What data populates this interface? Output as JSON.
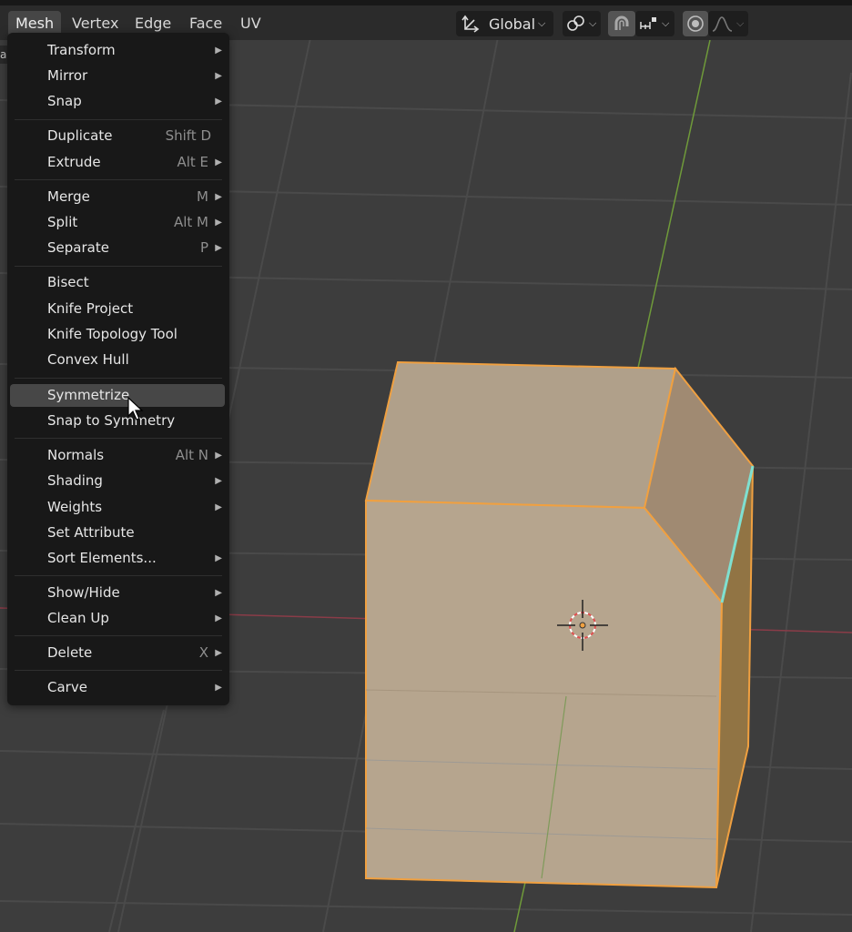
{
  "header": {
    "menus": [
      {
        "label": "Mesh",
        "active": true
      },
      {
        "label": "Vertex",
        "active": false
      },
      {
        "label": "Edge",
        "active": false
      },
      {
        "label": "Face",
        "active": false
      },
      {
        "label": "UV",
        "active": false
      }
    ],
    "orientation_label": "Global",
    "icons": [
      "transform-orientation-icon",
      "pivot-link-icon",
      "snap-magnet-icon",
      "snap-increment-icon",
      "proportional-edit-icon",
      "falloff-curve-icon"
    ]
  },
  "left_tab_label": "a",
  "dropdown": {
    "items": [
      {
        "label": "Transform",
        "shortcut": "",
        "submenu": true
      },
      {
        "label": "Mirror",
        "shortcut": "",
        "submenu": true
      },
      {
        "label": "Snap",
        "shortcut": "",
        "submenu": true
      },
      {
        "label": "Duplicate",
        "shortcut": "Shift D",
        "submenu": false
      },
      {
        "label": "Extrude",
        "shortcut": "Alt E",
        "submenu": true
      },
      {
        "label": "Merge",
        "shortcut": "M",
        "submenu": true
      },
      {
        "label": "Split",
        "shortcut": "Alt M",
        "submenu": true
      },
      {
        "label": "Separate",
        "shortcut": "P",
        "submenu": true
      },
      {
        "label": "Bisect",
        "shortcut": "",
        "submenu": false
      },
      {
        "label": "Knife Project",
        "shortcut": "",
        "submenu": false
      },
      {
        "label": "Knife Topology Tool",
        "shortcut": "",
        "submenu": false
      },
      {
        "label": "Convex Hull",
        "shortcut": "",
        "submenu": false
      },
      {
        "label": "Symmetrize",
        "shortcut": "",
        "submenu": false,
        "highlighted": true
      },
      {
        "label": "Snap to Symmetry",
        "shortcut": "",
        "submenu": false
      },
      {
        "label": "Normals",
        "shortcut": "Alt N",
        "submenu": true
      },
      {
        "label": "Shading",
        "shortcut": "",
        "submenu": true
      },
      {
        "label": "Weights",
        "shortcut": "",
        "submenu": true
      },
      {
        "label": "Set Attribute",
        "shortcut": "",
        "submenu": false
      },
      {
        "label": "Sort Elements...",
        "shortcut": "",
        "submenu": true
      },
      {
        "label": "Show/Hide",
        "shortcut": "",
        "submenu": true
      },
      {
        "label": "Clean Up",
        "shortcut": "",
        "submenu": true
      },
      {
        "label": "Delete",
        "shortcut": "X",
        "submenu": true
      },
      {
        "label": "Carve",
        "shortcut": "",
        "submenu": true
      }
    ]
  },
  "colors": {
    "viewport_bg": "#3d3d3d",
    "grid": "#4a4a4a",
    "x_axis": "#8a3c48",
    "y_axis": "#6f9a3a",
    "mesh_face": "#b6a58e",
    "mesh_side": "#a08a72",
    "mesh_dark_side": "#917444",
    "selection_outline": "#f0a040",
    "selected_edge": "#7fe0d0"
  }
}
